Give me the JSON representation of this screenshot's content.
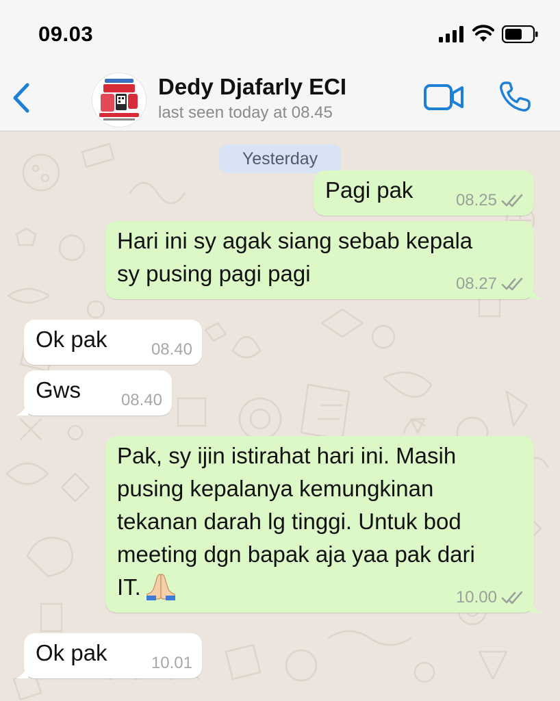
{
  "status_bar": {
    "time": "09.03"
  },
  "header": {
    "contact_name": "Dedy Djafarly ECI",
    "last_seen": "last seen today at 08.45"
  },
  "chat": {
    "date_separator": "Yesterday",
    "messages": [
      {
        "direction": "outgoing",
        "lines": [
          "Pagi pak"
        ],
        "time": "08.25",
        "status": "read"
      },
      {
        "direction": "outgoing",
        "lines": [
          "Hari ini sy agak siang sebab kepala",
          "sy pusing pagi pagi"
        ],
        "time": "08.27",
        "status": "read"
      },
      {
        "direction": "incoming",
        "lines": [
          "Ok pak"
        ],
        "time": "08.40"
      },
      {
        "direction": "incoming",
        "lines": [
          "Gws"
        ],
        "time": "08.40"
      },
      {
        "direction": "outgoing",
        "lines": [
          "Pak, sy ijin istirahat hari ini. Masih",
          "pusing kepalanya kemungkinan",
          "tekanan darah lg tinggi. Untuk bod",
          "meeting dgn bapak aja yaa pak dari",
          "IT."
        ],
        "emoji": "folded-hands",
        "time": "10.00",
        "status": "read"
      },
      {
        "direction": "incoming",
        "lines": [
          "Ok pak"
        ],
        "time": "10.01"
      }
    ]
  },
  "colors": {
    "accent": "#1d7fd6",
    "outgoing_bubble": "#dcf8c6",
    "incoming_bubble": "#ffffff",
    "chat_background": "#ece5dd",
    "date_pill": "#d8e4f5"
  }
}
